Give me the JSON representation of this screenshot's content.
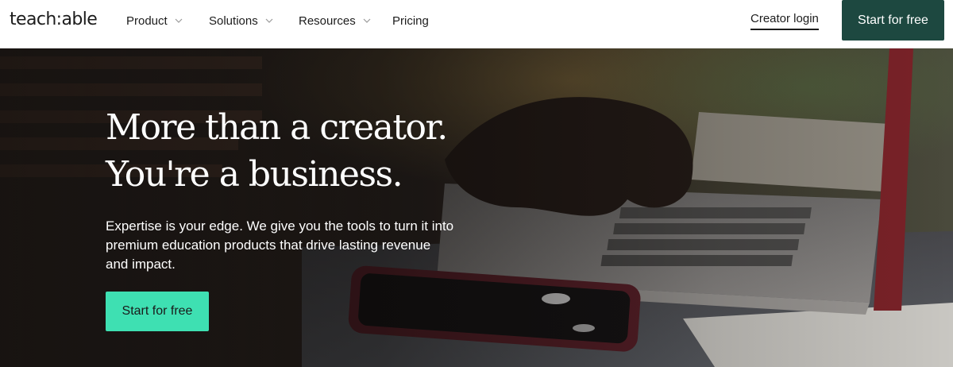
{
  "header": {
    "logo_text": "teach:able",
    "nav": [
      {
        "label": "Product",
        "has_dropdown": true,
        "icon": "chevron-down-icon"
      },
      {
        "label": "Solutions",
        "has_dropdown": true,
        "icon": "chevron-down-icon"
      },
      {
        "label": "Resources",
        "has_dropdown": true,
        "icon": "chevron-down-icon"
      },
      {
        "label": "Pricing",
        "has_dropdown": false
      }
    ],
    "creator_login": "Creator login",
    "start_for_free": "Start for free"
  },
  "hero": {
    "headline_line1": "More than a creator.",
    "headline_line2": "You're a business.",
    "subtext": "Expertise is your edge. We give you the tools to turn it into premium education products that drive lasting revenue and impact.",
    "cta": "Start for free",
    "background_image": "person typing on laptop with phone on desk"
  },
  "colors": {
    "top_cta_bg": "#1d4840",
    "hero_cta_bg": "#3ee0b2",
    "text_dark": "#1c1c1c",
    "text_light": "#ffffff"
  }
}
